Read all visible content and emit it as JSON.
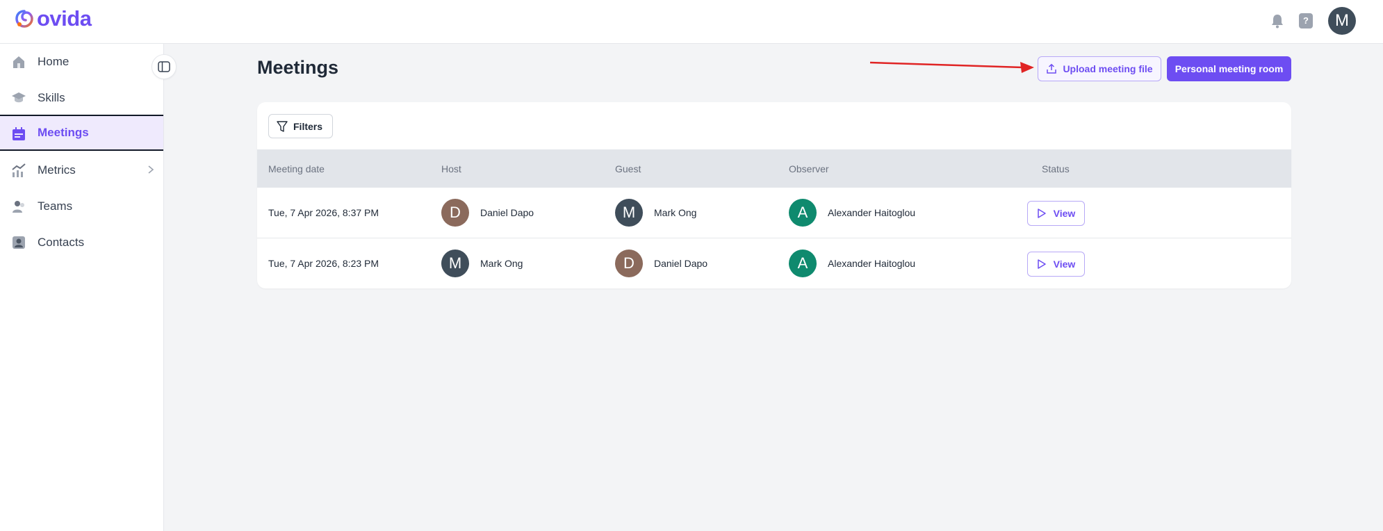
{
  "app": {
    "name": "ovida"
  },
  "header": {
    "help_label": "?",
    "user_initial": "M"
  },
  "sidebar": {
    "items": [
      {
        "label": "Home",
        "icon": "home-icon"
      },
      {
        "label": "Skills",
        "icon": "graduation-cap-icon"
      },
      {
        "label": "Meetings",
        "icon": "calendar-icon",
        "active": true
      },
      {
        "label": "Metrics",
        "icon": "chart-line-icon",
        "has_submenu": true
      },
      {
        "label": "Teams",
        "icon": "users-icon"
      },
      {
        "label": "Contacts",
        "icon": "contact-card-icon"
      }
    ]
  },
  "main": {
    "title": "Meetings",
    "upload_label": "Upload meeting file",
    "room_label": "Personal meeting room",
    "filters_label": "Filters",
    "columns": [
      "Meeting date",
      "Host",
      "Guest",
      "Observer",
      "Status"
    ],
    "rows": [
      {
        "date": "Tue, 7 Apr 2026, 8:37 PM",
        "host": {
          "initial": "D",
          "name": "Daniel Dapo",
          "color": "#8b6a5c"
        },
        "guest": {
          "initial": "M",
          "name": "Mark Ong",
          "color": "#3f4d5a"
        },
        "observer": {
          "initial": "A",
          "name": "Alexander Haitoglou",
          "color": "#0f8a6e"
        },
        "action": "View"
      },
      {
        "date": "Tue, 7 Apr 2026, 8:23 PM",
        "host": {
          "initial": "M",
          "name": "Mark Ong",
          "color": "#3f4d5a"
        },
        "guest": {
          "initial": "D",
          "name": "Daniel Dapo",
          "color": "#8b6a5c"
        },
        "observer": {
          "initial": "A",
          "name": "Alexander Haitoglou",
          "color": "#0f8a6e"
        },
        "action": "View"
      }
    ]
  },
  "colors": {
    "brand": "#6d4df2",
    "annotation_arrow": "#e02424"
  }
}
